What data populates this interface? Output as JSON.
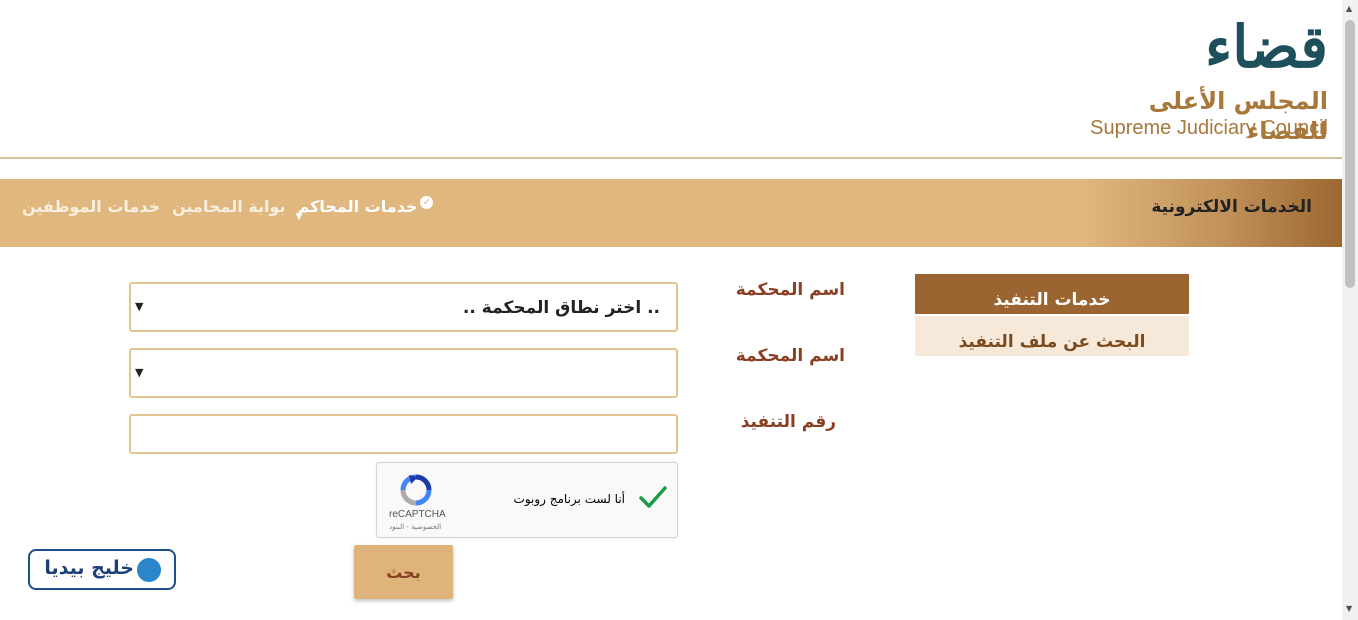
{
  "logo": {
    "arabic_big": "قضاء",
    "arabic_sub": "المجلس الأعلى للقضاء",
    "english": "Supreme Judiciary Council"
  },
  "navbar": {
    "title": "الخدمات الالكترونية",
    "items": [
      {
        "label": "خدمات الموظفين",
        "active": false
      },
      {
        "label": "بوابة المحامين",
        "active": false
      },
      {
        "label": "خدمات المحاكم",
        "active": true
      }
    ]
  },
  "sidebar": {
    "header": "خدمات التنفيذ",
    "items": [
      {
        "label": "البحث عن ملف التنفيذ"
      }
    ]
  },
  "form": {
    "court_scope_label": "اسم المحكمة",
    "court_scope_value": ".. اختر نطاق المحكمة ..",
    "court_name_label": "اسم المحكمة",
    "court_name_value": "",
    "execution_number_label": "رقم التنفيذ",
    "execution_number_value": "",
    "search_button": "بحث"
  },
  "recaptcha": {
    "label": "أنا لست برنامج روبوت",
    "brand": "reCAPTCHA",
    "terms": "الخصوصية - البنود"
  },
  "watermark": {
    "text": "خليج بيديا"
  },
  "colors": {
    "accent_brown": "#9b6532",
    "nav_gold": "#e0b77f",
    "label_red": "#8a3f22",
    "logo_teal": "#1d4f5c"
  }
}
